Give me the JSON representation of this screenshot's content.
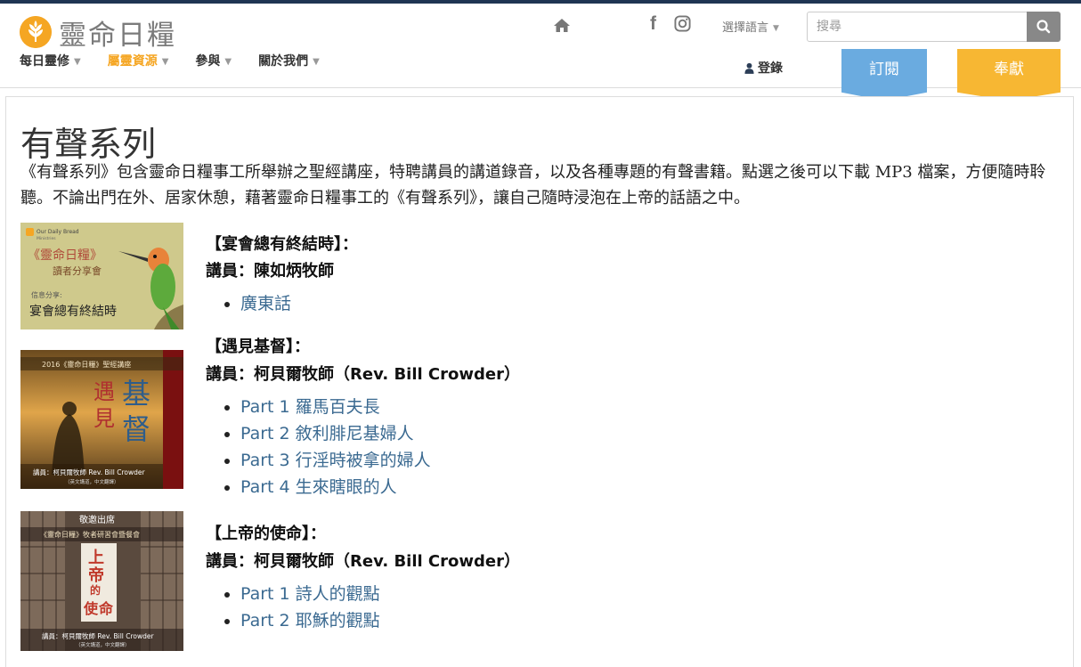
{
  "brand": {
    "name": "靈命日糧"
  },
  "nav": [
    {
      "label": "每日靈修",
      "active": false
    },
    {
      "label": "屬靈資源",
      "active": true
    },
    {
      "label": "參與",
      "active": false
    },
    {
      "label": "關於我們",
      "active": false
    }
  ],
  "header": {
    "language_label": "選擇語言",
    "search_placeholder": "搜尋",
    "login_label": "登錄",
    "subscribe_label": "訂閱",
    "donate_label": "奉獻"
  },
  "colors": {
    "accent": "#f5a623",
    "link": "#3b6a91",
    "subscribe": "#6aabe0",
    "donate": "#f7b733",
    "topbar": "#1f3553"
  },
  "icons": [
    "home-icon",
    "facebook-icon",
    "instagram-icon",
    "search-icon",
    "user-icon"
  ],
  "page": {
    "title": "有聲系列",
    "intro": "《有聲系列》包含靈命日糧事工所舉辦之聖經講座，特聘講員的講道錄音，以及各種專題的有聲書籍。點選之後可以下載 MP3 檔案，方便隨時聆聽。不論出門在外、居家休憩，藉著靈命日糧事工的《有聲系列》，讓自己隨時浸泡在上帝的話語之中。"
  },
  "series": [
    {
      "title": "【宴會總有終結時】：",
      "speaker": "講員：陳如炳牧師",
      "parts": [
        "廣東話"
      ],
      "thumb": {
        "brand": "Our Daily Bread",
        "brand_sub": "Ministries",
        "heading": "《靈命日糧》",
        "subheading": "讀者分享會",
        "share_label": "信息分享:",
        "topic": "宴會總有終結時"
      }
    },
    {
      "title": "【遇見基督】：",
      "speaker": "講員：柯貝爾牧師（Rev. Bill Crowder）",
      "parts": [
        "Part 1 羅馬百夫長",
        "Part 2 敘利腓尼基婦人",
        "Part 3 行淫時被拿的婦人",
        "Part 4 生來瞎眼的人"
      ],
      "thumb": {
        "banner": "2016《靈命日糧》聖經講座",
        "char1": "遇",
        "char2": "見",
        "char3": "基",
        "char4": "督",
        "speaker": "講員：柯貝爾牧師 Rev. Bill Crowder",
        "note": "（英文講道，中文翻譯）"
      }
    },
    {
      "title": "【上帝的使命】：",
      "speaker": "講員：柯貝爾牧師（Rev. Bill Crowder）",
      "parts": [
        "Part 1 詩人的觀點",
        "Part 2 耶穌的觀點"
      ],
      "thumb": {
        "invite": "敬邀出席",
        "banner": "《靈命日糧》牧者研習會暨餐會",
        "char1": "上",
        "char2": "帝",
        "char3": "的",
        "char4": "使",
        "char5": "命",
        "speaker": "講員：柯貝爾牧師 Rev. Bill Crowder",
        "note": "（英文講道，中文翻譯）"
      }
    }
  ]
}
